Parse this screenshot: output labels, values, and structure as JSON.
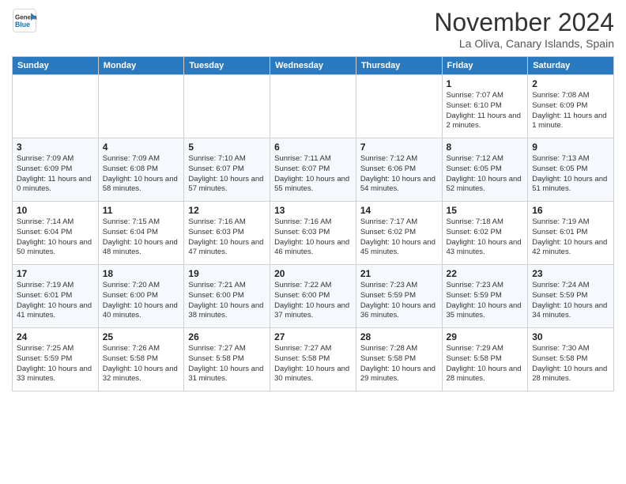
{
  "header": {
    "logo_line1": "General",
    "logo_line2": "Blue",
    "month": "November 2024",
    "location": "La Oliva, Canary Islands, Spain"
  },
  "weekdays": [
    "Sunday",
    "Monday",
    "Tuesday",
    "Wednesday",
    "Thursday",
    "Friday",
    "Saturday"
  ],
  "weeks": [
    [
      {
        "day": "",
        "info": ""
      },
      {
        "day": "",
        "info": ""
      },
      {
        "day": "",
        "info": ""
      },
      {
        "day": "",
        "info": ""
      },
      {
        "day": "",
        "info": ""
      },
      {
        "day": "1",
        "info": "Sunrise: 7:07 AM\nSunset: 6:10 PM\nDaylight: 11 hours and 2 minutes."
      },
      {
        "day": "2",
        "info": "Sunrise: 7:08 AM\nSunset: 6:09 PM\nDaylight: 11 hours and 1 minute."
      }
    ],
    [
      {
        "day": "3",
        "info": "Sunrise: 7:09 AM\nSunset: 6:09 PM\nDaylight: 11 hours and 0 minutes."
      },
      {
        "day": "4",
        "info": "Sunrise: 7:09 AM\nSunset: 6:08 PM\nDaylight: 10 hours and 58 minutes."
      },
      {
        "day": "5",
        "info": "Sunrise: 7:10 AM\nSunset: 6:07 PM\nDaylight: 10 hours and 57 minutes."
      },
      {
        "day": "6",
        "info": "Sunrise: 7:11 AM\nSunset: 6:07 PM\nDaylight: 10 hours and 55 minutes."
      },
      {
        "day": "7",
        "info": "Sunrise: 7:12 AM\nSunset: 6:06 PM\nDaylight: 10 hours and 54 minutes."
      },
      {
        "day": "8",
        "info": "Sunrise: 7:12 AM\nSunset: 6:05 PM\nDaylight: 10 hours and 52 minutes."
      },
      {
        "day": "9",
        "info": "Sunrise: 7:13 AM\nSunset: 6:05 PM\nDaylight: 10 hours and 51 minutes."
      }
    ],
    [
      {
        "day": "10",
        "info": "Sunrise: 7:14 AM\nSunset: 6:04 PM\nDaylight: 10 hours and 50 minutes."
      },
      {
        "day": "11",
        "info": "Sunrise: 7:15 AM\nSunset: 6:04 PM\nDaylight: 10 hours and 48 minutes."
      },
      {
        "day": "12",
        "info": "Sunrise: 7:16 AM\nSunset: 6:03 PM\nDaylight: 10 hours and 47 minutes."
      },
      {
        "day": "13",
        "info": "Sunrise: 7:16 AM\nSunset: 6:03 PM\nDaylight: 10 hours and 46 minutes."
      },
      {
        "day": "14",
        "info": "Sunrise: 7:17 AM\nSunset: 6:02 PM\nDaylight: 10 hours and 45 minutes."
      },
      {
        "day": "15",
        "info": "Sunrise: 7:18 AM\nSunset: 6:02 PM\nDaylight: 10 hours and 43 minutes."
      },
      {
        "day": "16",
        "info": "Sunrise: 7:19 AM\nSunset: 6:01 PM\nDaylight: 10 hours and 42 minutes."
      }
    ],
    [
      {
        "day": "17",
        "info": "Sunrise: 7:19 AM\nSunset: 6:01 PM\nDaylight: 10 hours and 41 minutes."
      },
      {
        "day": "18",
        "info": "Sunrise: 7:20 AM\nSunset: 6:00 PM\nDaylight: 10 hours and 40 minutes."
      },
      {
        "day": "19",
        "info": "Sunrise: 7:21 AM\nSunset: 6:00 PM\nDaylight: 10 hours and 38 minutes."
      },
      {
        "day": "20",
        "info": "Sunrise: 7:22 AM\nSunset: 6:00 PM\nDaylight: 10 hours and 37 minutes."
      },
      {
        "day": "21",
        "info": "Sunrise: 7:23 AM\nSunset: 5:59 PM\nDaylight: 10 hours and 36 minutes."
      },
      {
        "day": "22",
        "info": "Sunrise: 7:23 AM\nSunset: 5:59 PM\nDaylight: 10 hours and 35 minutes."
      },
      {
        "day": "23",
        "info": "Sunrise: 7:24 AM\nSunset: 5:59 PM\nDaylight: 10 hours and 34 minutes."
      }
    ],
    [
      {
        "day": "24",
        "info": "Sunrise: 7:25 AM\nSunset: 5:59 PM\nDaylight: 10 hours and 33 minutes."
      },
      {
        "day": "25",
        "info": "Sunrise: 7:26 AM\nSunset: 5:58 PM\nDaylight: 10 hours and 32 minutes."
      },
      {
        "day": "26",
        "info": "Sunrise: 7:27 AM\nSunset: 5:58 PM\nDaylight: 10 hours and 31 minutes."
      },
      {
        "day": "27",
        "info": "Sunrise: 7:27 AM\nSunset: 5:58 PM\nDaylight: 10 hours and 30 minutes."
      },
      {
        "day": "28",
        "info": "Sunrise: 7:28 AM\nSunset: 5:58 PM\nDaylight: 10 hours and 29 minutes."
      },
      {
        "day": "29",
        "info": "Sunrise: 7:29 AM\nSunset: 5:58 PM\nDaylight: 10 hours and 28 minutes."
      },
      {
        "day": "30",
        "info": "Sunrise: 7:30 AM\nSunset: 5:58 PM\nDaylight: 10 hours and 28 minutes."
      }
    ]
  ]
}
